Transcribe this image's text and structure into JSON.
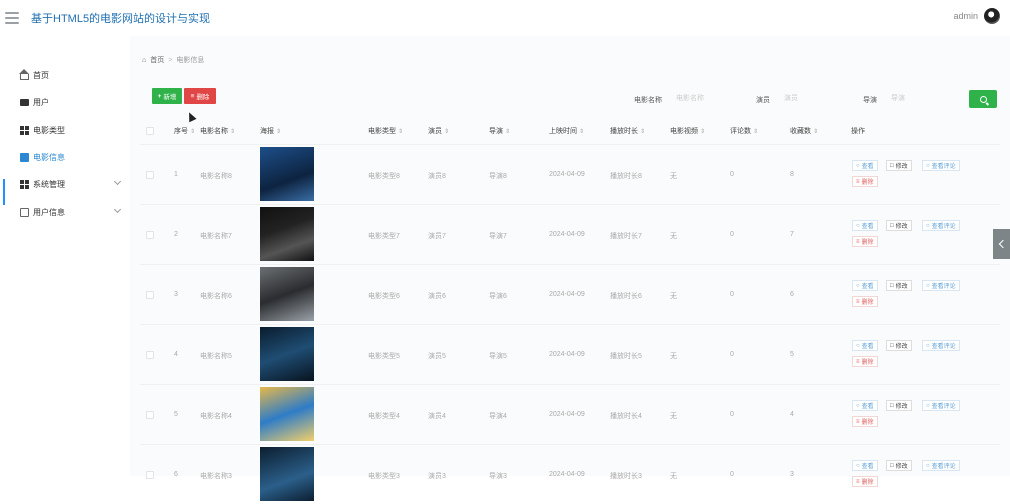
{
  "app": {
    "title": "基于HTML5的电影网站的设计与实现",
    "username": "admin"
  },
  "sidebar": {
    "items": [
      {
        "label": "首页",
        "icon": "home-icon"
      },
      {
        "label": "用户",
        "icon": "monitor-icon"
      },
      {
        "label": "电影类型",
        "icon": "grid-icon"
      },
      {
        "label": "电影信息",
        "icon": "film-icon",
        "active": true
      },
      {
        "label": "系统管理",
        "icon": "grid-icon",
        "expandable": true
      },
      {
        "label": "用户信息",
        "icon": "card-icon",
        "expandable": true
      }
    ]
  },
  "breadcrumb": {
    "home": "首页",
    "separator": ">",
    "current": "电影信息"
  },
  "toolbar": {
    "add_label": "新增",
    "delete_label": "删除"
  },
  "filters": [
    {
      "label": "电影名称",
      "placeholder": "电影名称"
    },
    {
      "label": "演员",
      "placeholder": "演员"
    },
    {
      "label": "导演",
      "placeholder": "导演"
    }
  ],
  "table": {
    "headers": [
      "序号",
      "电影名称",
      "海报",
      "电影类型",
      "演员",
      "导演",
      "上映时间",
      "播放时长",
      "电影视频",
      "评论数",
      "收藏数",
      "操作"
    ],
    "rows": [
      {
        "index": "1",
        "name": "电影名称8",
        "type": "电影类型8",
        "actor": "演员8",
        "director": "导演8",
        "date": "2024-04-09",
        "duration": "播放时长8",
        "video": "无",
        "comments": "0",
        "favorites": "8"
      },
      {
        "index": "2",
        "name": "电影名称7",
        "type": "电影类型7",
        "actor": "演员7",
        "director": "导演7",
        "date": "2024-04-09",
        "duration": "播放时长7",
        "video": "无",
        "comments": "0",
        "favorites": "7"
      },
      {
        "index": "3",
        "name": "电影名称6",
        "type": "电影类型6",
        "actor": "演员6",
        "director": "导演6",
        "date": "2024-04-09",
        "duration": "播放时长6",
        "video": "无",
        "comments": "0",
        "favorites": "6"
      },
      {
        "index": "4",
        "name": "电影名称5",
        "type": "电影类型5",
        "actor": "演员5",
        "director": "导演5",
        "date": "2024-04-09",
        "duration": "播放时长5",
        "video": "无",
        "comments": "0",
        "favorites": "5"
      },
      {
        "index": "5",
        "name": "电影名称4",
        "type": "电影类型4",
        "actor": "演员4",
        "director": "导演4",
        "date": "2024-04-09",
        "duration": "播放时长4",
        "video": "无",
        "comments": "0",
        "favorites": "4"
      },
      {
        "index": "6",
        "name": "电影名称3",
        "type": "电影类型3",
        "actor": "演员3",
        "director": "导演3",
        "date": "2024-04-09",
        "duration": "播放时长3",
        "video": "无",
        "comments": "0",
        "favorites": "3"
      }
    ],
    "actions": {
      "view": "查看",
      "edit": "修改",
      "comments": "查看评论",
      "delete": "删除"
    }
  },
  "colors": {
    "accent": "#2fb24a",
    "danger": "#e04646",
    "link": "#5c9fd6",
    "active": "#1e90ff"
  }
}
